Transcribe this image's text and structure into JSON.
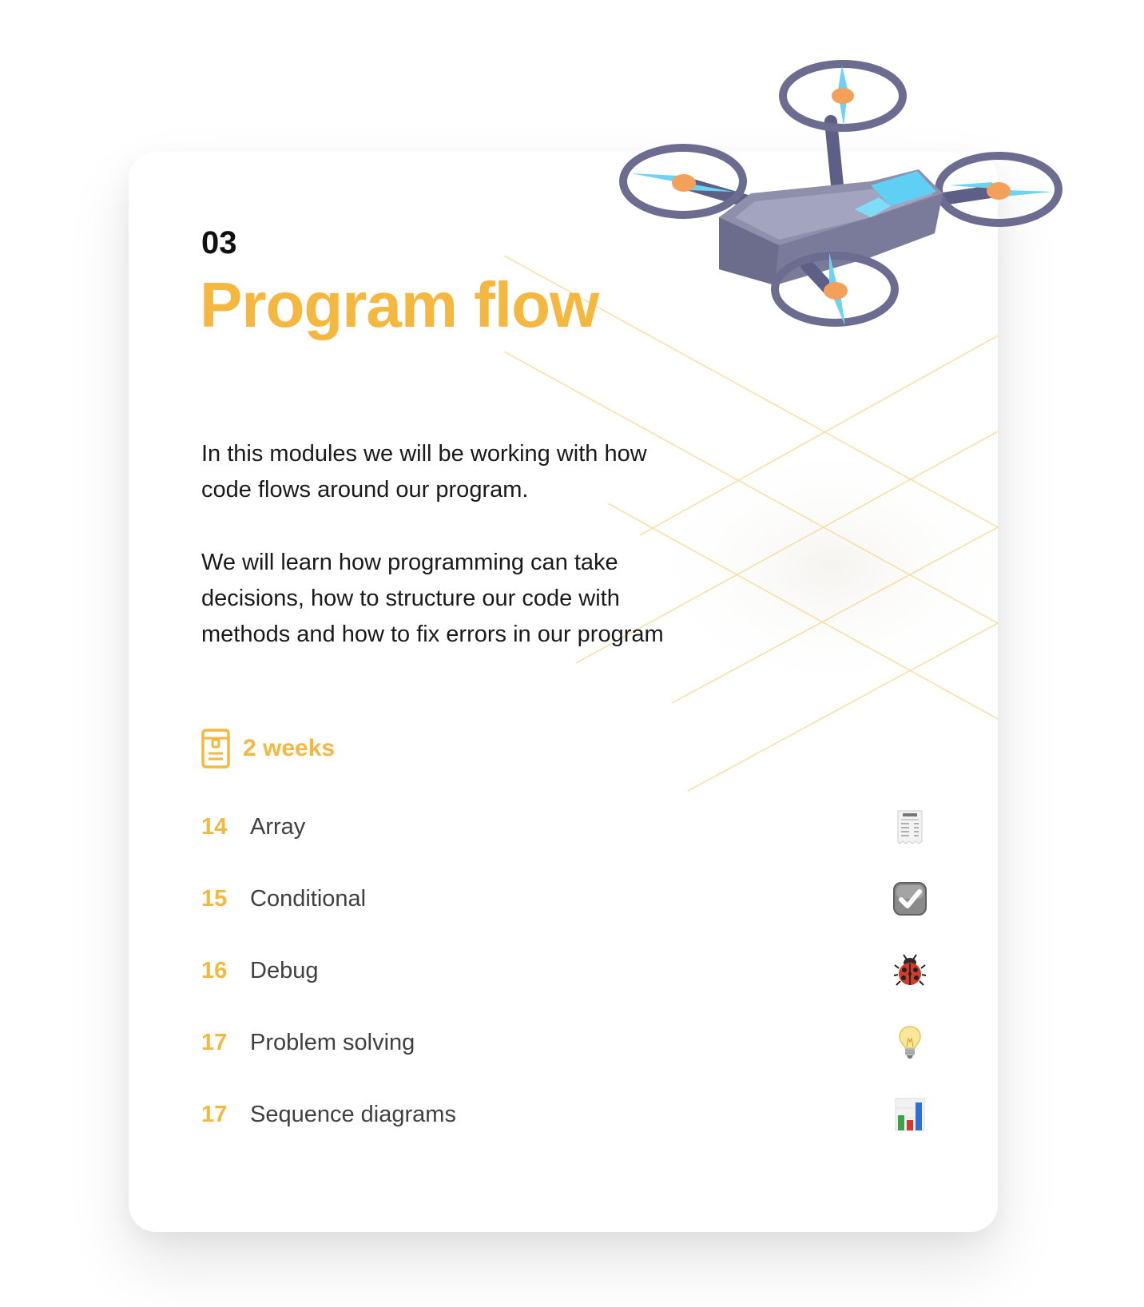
{
  "module": {
    "number": "03",
    "title": "Program flow",
    "description_1": "In this modules we will be working with how code flows around our program.",
    "description_2": "We will learn how programming can take decisions, how to structure our code with methods and how to fix errors in our program",
    "duration": "2 weeks",
    "duration_icon": "calendar-icon",
    "accent_color": "#F4B73F"
  },
  "lessons": [
    {
      "number": "14",
      "name": "Array",
      "icon": "receipt-icon"
    },
    {
      "number": "15",
      "name": "Conditional",
      "icon": "checkbox-icon"
    },
    {
      "number": "16",
      "name": "Debug",
      "icon": "ladybug-icon"
    },
    {
      "number": "17",
      "name": "Problem solving",
      "icon": "lightbulb-icon"
    },
    {
      "number": "17",
      "name": "Sequence diagrams",
      "icon": "bar-chart-icon"
    }
  ]
}
